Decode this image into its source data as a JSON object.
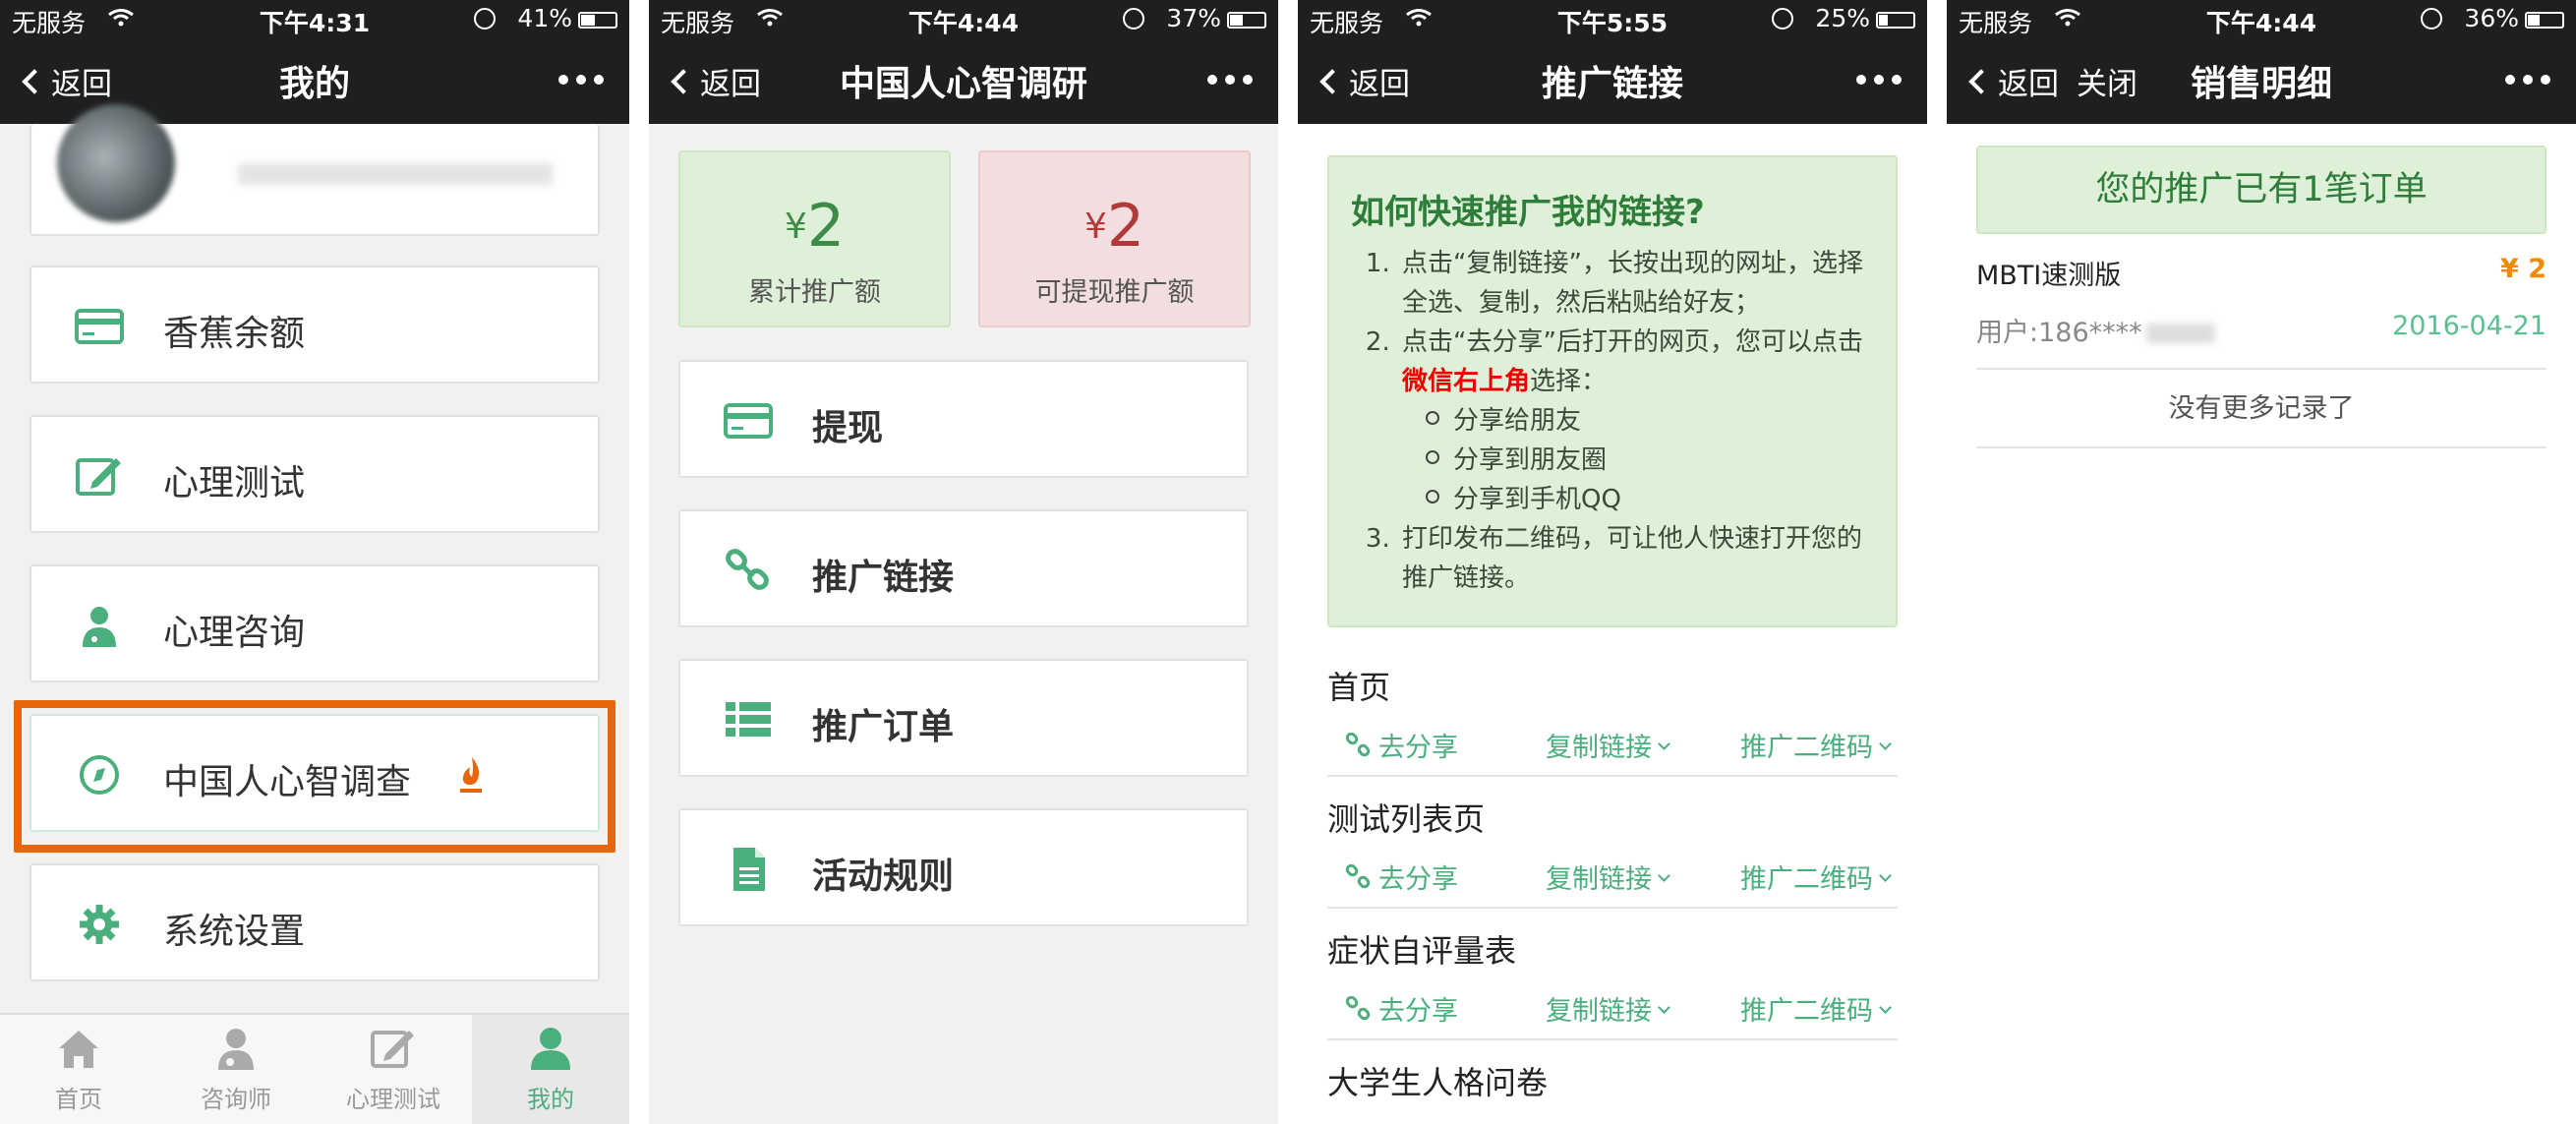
{
  "p1": {
    "status": {
      "carrier": "无服务",
      "time": "下午4:31",
      "battery": "41%",
      "battery_level": 0.41
    },
    "nav": {
      "back": "返回",
      "title": "我的"
    },
    "menu": [
      {
        "label": "香蕉余额",
        "icon": "card-icon"
      },
      {
        "label": "心理测试",
        "icon": "edit-icon"
      },
      {
        "label": "心理咨询",
        "icon": "doctor-icon"
      },
      {
        "label": "中国人心智调查",
        "icon": "compass-icon",
        "badge_icon": "flame-icon"
      },
      {
        "label": "系统设置",
        "icon": "gear-icon"
      }
    ],
    "tabs": [
      {
        "label": "首页",
        "icon": "home-icon"
      },
      {
        "label": "咨询师",
        "icon": "counselor-icon"
      },
      {
        "label": "心理测试",
        "icon": "edit-icon"
      },
      {
        "label": "我的",
        "icon": "user-icon",
        "active": true
      }
    ]
  },
  "p2": {
    "status": {
      "carrier": "无服务",
      "time": "下午4:44",
      "battery": "37%",
      "battery_level": 0.37
    },
    "nav": {
      "back": "返回",
      "title": "中国人心智调研"
    },
    "stats": [
      {
        "currency": "¥",
        "value": "2",
        "caption": "累计推广额",
        "color": "#3d8b47",
        "bg": "#dff0d8",
        "border": "#cde5c1"
      },
      {
        "currency": "¥",
        "value": "2",
        "caption": "可提现推广额",
        "color": "#b03a3a",
        "bg": "#f2dede",
        "border": "#ebcccc"
      }
    ],
    "menu": [
      {
        "label": "提现",
        "icon": "card-icon"
      },
      {
        "label": "推广链接",
        "icon": "link-icon"
      },
      {
        "label": "推广订单",
        "icon": "list-icon"
      },
      {
        "label": "活动规则",
        "icon": "document-icon"
      }
    ]
  },
  "p3": {
    "status": {
      "carrier": "无服务",
      "time": "下午5:55",
      "battery": "25%",
      "battery_level": 0.25
    },
    "nav": {
      "back": "返回",
      "title": "推广链接"
    },
    "tip": {
      "heading": "如何快速推广我的链接?",
      "step1": "点击“复制链接”，长按出现的网址，选择全选、复制，然后粘贴给好友；",
      "step2_pre": "点击“去分享”后打开的网页，您可以点击",
      "step2_red": "微信右上角",
      "step2_post": "选择：",
      "share_options": [
        "分享给朋友",
        "分享到朋友圈",
        "分享到手机QQ"
      ],
      "step3": "打印发布二维码，可让他人快速打开您的推广链接。"
    },
    "actions": {
      "share": "去分享",
      "copy": "复制链接",
      "qr": "推广二维码"
    },
    "sections": [
      "首页",
      "测试列表页",
      "症状自评量表",
      "大学生人格问卷"
    ]
  },
  "p4": {
    "status": {
      "carrier": "无服务",
      "time": "下午4:44",
      "battery": "36%",
      "battery_level": 0.36
    },
    "nav": {
      "back": "返回",
      "close": "关闭",
      "title": "销售明细"
    },
    "banner": "您的推广已有1笔订单",
    "order": {
      "product": "MBTI速测版",
      "amount": "¥ 2",
      "user": "用户:186****",
      "date": "2016-04-21"
    },
    "no_more": "没有更多记录了"
  }
}
